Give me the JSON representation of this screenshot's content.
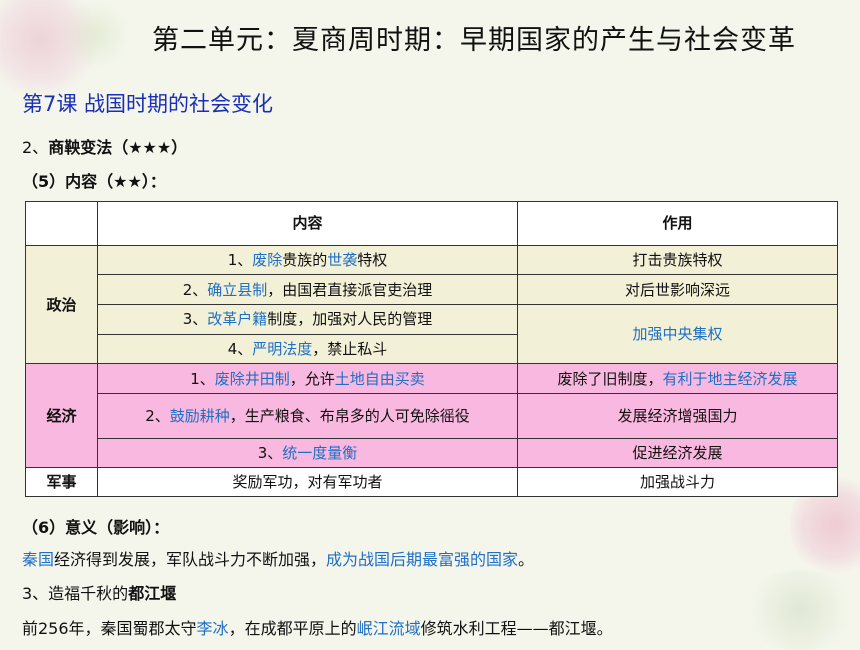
{
  "header": {
    "title": "第二单元：夏商周时期：早期国家的产生与社会变革",
    "lesson": "第7课  战国时期的社会变化"
  },
  "section2": {
    "heading_prefix": "2、",
    "heading": "商鞅变法（★★★）",
    "sub5": "（5）内容（★★）："
  },
  "table": {
    "headers": [
      "",
      "内容",
      "作用"
    ],
    "politics": {
      "category": "政治",
      "rows": [
        {
          "pre": "1、",
          "h1": "废除",
          "mid": "贵族的",
          "h2": "世袭",
          "post": "特权",
          "impact": "打击贵族特权"
        },
        {
          "pre": "2、",
          "h1": "确立县制",
          "mid": "，由国君直接派官吏治理",
          "h2": "",
          "post": "",
          "impact": "对后世影响深远"
        },
        {
          "pre": "3、",
          "h1": "改革户籍",
          "mid": "制度，加强对人民的管理",
          "h2": "",
          "post": "",
          "impact": "加强中央集权"
        },
        {
          "pre": "4、",
          "h1": "严明法度",
          "mid": "，禁止私斗",
          "h2": "",
          "post": "",
          "impact": ""
        }
      ]
    },
    "economy": {
      "category": "经济",
      "rows": [
        {
          "pre": "1、",
          "h1": "废除井田制",
          "mid": "，允许",
          "h2": "土地自由买卖",
          "post": "",
          "impact_plain": "废除了旧制度，",
          "impact_blue": "有利于地主经济发展"
        },
        {
          "pre": "2、",
          "h1": "鼓励耕种",
          "mid": "，生产粮食、布帛多的人可免除徭役",
          "h2": "",
          "post": "",
          "impact_plain": "发展经济增强国力",
          "impact_blue": ""
        },
        {
          "pre": "3、",
          "h1": "统一度量衡",
          "mid": "",
          "h2": "",
          "post": "",
          "impact_plain": "促进经济发展",
          "impact_blue": ""
        }
      ]
    },
    "military": {
      "category": "军事",
      "content": "奖励军功，对有军功者",
      "impact": "加强战斗力"
    }
  },
  "section6": {
    "heading": "（6）意义（影响）：",
    "p_blue1": "秦国",
    "p_mid": "经济得到发展，军队战斗力不断加强，",
    "p_blue2": "成为战国后期最富强的国家",
    "p_end": "。"
  },
  "section3": {
    "heading_prefix": "3、造福千秋的",
    "heading_bold": "都江堰",
    "p_pre": "前256年，秦国蜀郡太守",
    "p_blue1": "李冰",
    "p_mid": "，在成都平原上的",
    "p_blue2": "岷江流域",
    "p_end": "修筑水利工程——都江堰。"
  }
}
